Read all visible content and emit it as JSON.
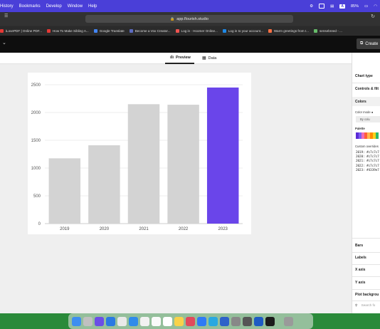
{
  "menubar": {
    "items": [
      "History",
      "Bookmarks",
      "Develop",
      "Window",
      "Help"
    ],
    "battery": "85%"
  },
  "browser": {
    "url": "app.flourish.studio",
    "bookmarks": [
      {
        "label": "iLovePDF | Online PDF...",
        "color": "#e53935"
      },
      {
        "label": "How To Make Sibling A...",
        "color": "#e53935"
      },
      {
        "label": "Google Translate",
        "color": "#4285f4"
      },
      {
        "label": "Become a Vox Creator...",
        "color": "#5c6bc0"
      },
      {
        "label": "Log in · Hoomer Online...",
        "color": "#ef5350"
      },
      {
        "label": "Log in to your account...",
        "color": "#1e88e5"
      },
      {
        "label": "Warm greetings from I...",
        "color": "#ff7043"
      },
      {
        "label": "sensebreed - ...",
        "color": "#66bb6a"
      }
    ]
  },
  "toolbar": {
    "create_label": "Create"
  },
  "tabs": {
    "preview": "Preview",
    "data": "Data"
  },
  "panel": {
    "chart_type": "Chart type",
    "controls": "Controls & filt",
    "colors": "Colors",
    "color_mode": "Color mode",
    "by_column": "By colu",
    "palette_label": "Palette",
    "palette": [
      "#5b2bd6",
      "#7b5cf0",
      "#f06bb5",
      "#ff5f3b",
      "#ffb74d",
      "#ff8a00",
      "#f7d21b",
      "#2fb86b"
    ],
    "custom_overrides": "Custom overrides",
    "overrides": [
      "2019: #c7c7c7",
      "2020: #c7c7c7",
      "2021: #c7c7c7",
      "2022: #c7c7c7",
      "2023: #4339e7"
    ],
    "bars": "Bars",
    "labels": "Labels",
    "x_axis": "X axis",
    "y_axis": "Y axis",
    "plot_background": "Plot backgrou",
    "search_placeholder": "Search fo"
  },
  "chart_data": {
    "type": "bar",
    "categories": [
      "2019",
      "2020",
      "2021",
      "2022",
      "2023"
    ],
    "values": [
      1175,
      1410,
      2150,
      2140,
      2450
    ],
    "colors": [
      "#d3d3d3",
      "#d3d3d3",
      "#d3d3d3",
      "#d3d3d3",
      "#6a45ea"
    ],
    "ylim": [
      0,
      2500
    ],
    "yticks": [
      0,
      500,
      1000,
      1500,
      2000,
      2500
    ],
    "grid": true,
    "title": "",
    "xlabel": "",
    "ylabel": ""
  }
}
